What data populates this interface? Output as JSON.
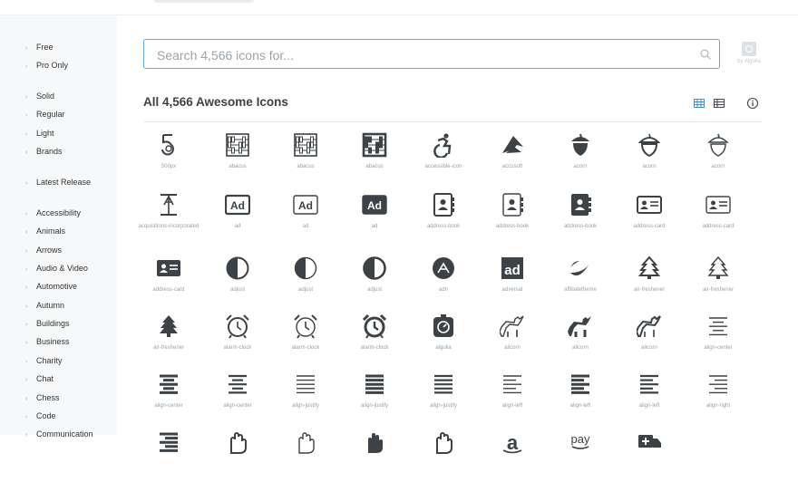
{
  "search": {
    "placeholder": "Search 4,566 icons for..."
  },
  "ad_label": "by Algolia",
  "heading": "All 4,566 Awesome Icons",
  "sidebar": {
    "items": [
      {
        "label": "Free"
      },
      {
        "label": "Pro Only"
      },
      {
        "label": "Solid"
      },
      {
        "label": "Regular"
      },
      {
        "label": "Light"
      },
      {
        "label": "Brands"
      },
      {
        "label": "Latest Release"
      },
      {
        "label": "Accessibility"
      },
      {
        "label": "Animals"
      },
      {
        "label": "Arrows"
      },
      {
        "label": "Audio & Video"
      },
      {
        "label": "Automotive"
      },
      {
        "label": "Autumn"
      },
      {
        "label": "Buildings"
      },
      {
        "label": "Business"
      },
      {
        "label": "Charity"
      },
      {
        "label": "Chat"
      },
      {
        "label": "Chess"
      },
      {
        "label": "Code"
      },
      {
        "label": "Communication"
      }
    ]
  },
  "icons": [
    {
      "name": "500px",
      "icon": "five-hundred-px-icon"
    },
    {
      "name": "abacus",
      "icon": "abacus-icon"
    },
    {
      "name": "abacus",
      "icon": "abacus-icon"
    },
    {
      "name": "abacus",
      "icon": "abacus-icon"
    },
    {
      "name": "accessible-icon",
      "icon": "accessible-icon"
    },
    {
      "name": "accusoft",
      "icon": "accusoft-icon"
    },
    {
      "name": "acorn",
      "icon": "acorn-icon"
    },
    {
      "name": "acorn",
      "icon": "acorn-icon"
    },
    {
      "name": "acorn",
      "icon": "acorn-icon"
    },
    {
      "name": "acquisitions-incorporated",
      "icon": "acquisitions-incorporated-icon"
    },
    {
      "name": "ad",
      "icon": "ad-icon"
    },
    {
      "name": "ad",
      "icon": "ad-icon"
    },
    {
      "name": "ad",
      "icon": "ad-icon"
    },
    {
      "name": "address-book",
      "icon": "address-book-icon"
    },
    {
      "name": "address-book",
      "icon": "address-book-icon"
    },
    {
      "name": "address-book",
      "icon": "address-book-icon"
    },
    {
      "name": "address-card",
      "icon": "address-card-icon"
    },
    {
      "name": "address-card",
      "icon": "address-card-icon"
    },
    {
      "name": "address-card",
      "icon": "address-card-icon"
    },
    {
      "name": "adjust",
      "icon": "adjust-icon"
    },
    {
      "name": "adjust",
      "icon": "adjust-icon"
    },
    {
      "name": "adjust",
      "icon": "adjust-icon"
    },
    {
      "name": "adn",
      "icon": "adn-icon"
    },
    {
      "name": "adversal",
      "icon": "adversal-icon"
    },
    {
      "name": "affiliatetheme",
      "icon": "affiliatetheme-icon"
    },
    {
      "name": "air-freshener",
      "icon": "air-freshener-icon"
    },
    {
      "name": "air-freshener",
      "icon": "air-freshener-icon"
    },
    {
      "name": "air-freshener",
      "icon": "air-freshener-icon"
    },
    {
      "name": "alarm-clock",
      "icon": "alarm-clock-icon"
    },
    {
      "name": "alarm-clock",
      "icon": "alarm-clock-icon"
    },
    {
      "name": "alarm-clock",
      "icon": "alarm-clock-icon"
    },
    {
      "name": "algolia",
      "icon": "algolia-icon"
    },
    {
      "name": "alicorn",
      "icon": "alicorn-icon"
    },
    {
      "name": "alicorn",
      "icon": "alicorn-icon"
    },
    {
      "name": "alicorn",
      "icon": "alicorn-icon"
    },
    {
      "name": "align-center",
      "icon": "align-center-icon"
    },
    {
      "name": "align-center",
      "icon": "align-center-icon"
    },
    {
      "name": "align-center",
      "icon": "align-center-icon"
    },
    {
      "name": "align-justify",
      "icon": "align-justify-icon"
    },
    {
      "name": "align-justify",
      "icon": "align-justify-icon"
    },
    {
      "name": "align-justify",
      "icon": "align-justify-icon"
    },
    {
      "name": "align-left",
      "icon": "align-left-icon"
    },
    {
      "name": "align-left",
      "icon": "align-left-icon"
    },
    {
      "name": "align-left",
      "icon": "align-left-icon"
    },
    {
      "name": "align-right",
      "icon": "align-right-icon"
    },
    {
      "name": "",
      "icon": "align-right-icon"
    },
    {
      "name": "",
      "icon": "allergies-icon"
    },
    {
      "name": "",
      "icon": "allergies-icon"
    },
    {
      "name": "",
      "icon": "allergies-icon"
    },
    {
      "name": "",
      "icon": "allergies-icon"
    },
    {
      "name": "",
      "icon": "amazon-icon"
    },
    {
      "name": "",
      "icon": "amazon-pay-icon"
    },
    {
      "name": "",
      "icon": "ambulance-icon"
    }
  ],
  "glyph_text": {
    "ad": "Ad",
    "pay": "pay"
  },
  "colors": {
    "icon": "#3d4247",
    "accent": "#5ba7e8",
    "sidebar_bg": "#f7f8f9"
  }
}
